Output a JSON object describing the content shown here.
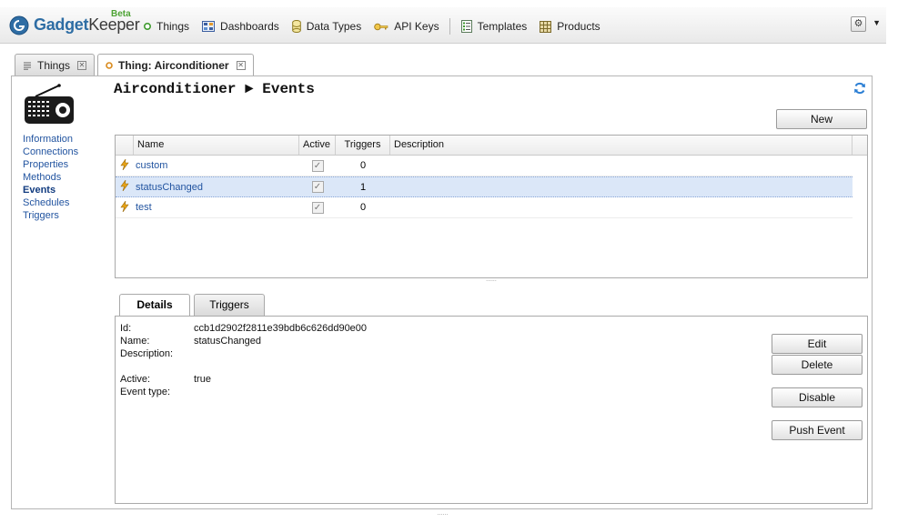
{
  "app": {
    "brand": "Gadget",
    "brand_suffix": "Keeper",
    "beta": "Beta"
  },
  "nav": {
    "things": "Things",
    "dashboards": "Dashboards",
    "data_types": "Data Types",
    "api_keys": "API Keys",
    "templates": "Templates",
    "products": "Products"
  },
  "tabs": {
    "things": "Things",
    "current": "Thing: Airconditioner"
  },
  "sidebar": {
    "items": [
      "Information",
      "Connections",
      "Properties",
      "Methods",
      "Events",
      "Schedules",
      "Triggers"
    ],
    "selected": "Events"
  },
  "breadcrumb": {
    "thing": "Airconditioner",
    "separator": "►",
    "section": "Events"
  },
  "buttons": {
    "new": "New",
    "edit": "Edit",
    "delete": "Delete",
    "disable": "Disable",
    "push_event": "Push Event"
  },
  "grid": {
    "columns": [
      "Name",
      "Active",
      "Triggers",
      "Description"
    ],
    "rows": [
      {
        "name": "custom",
        "active": true,
        "triggers": "0",
        "description": ""
      },
      {
        "name": "statusChanged",
        "active": true,
        "triggers": "1",
        "description": ""
      },
      {
        "name": "test",
        "active": true,
        "triggers": "0",
        "description": ""
      }
    ],
    "selected_row": 1
  },
  "details": {
    "tabs": [
      "Details",
      "Triggers"
    ],
    "labels": {
      "id": "Id:",
      "name": "Name:",
      "description": "Description:",
      "active": "Active:",
      "event_type": "Event type:"
    },
    "values": {
      "id": "ccb1d2902f2811e39bdb6c626dd90e00",
      "name": "statusChanged",
      "description": "",
      "active": "true",
      "event_type": ""
    }
  },
  "colors": {
    "link": "#2254a0",
    "selection": "#dbe7f8",
    "brand_blue": "#2e6da4",
    "beta_green": "#4da334"
  },
  "icons": {
    "event_row": "lightning-icon",
    "thing": "radio-icon",
    "refresh": "refresh-icon",
    "settings": "gear-icon"
  }
}
